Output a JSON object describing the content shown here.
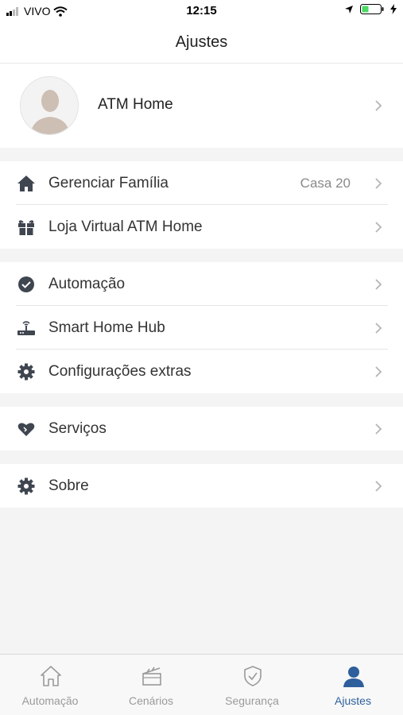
{
  "status_bar": {
    "carrier": "VIVO",
    "time": "12:15"
  },
  "header": {
    "title": "Ajustes"
  },
  "profile": {
    "name": "ATM Home"
  },
  "groups": [
    {
      "items": [
        {
          "label": "Gerenciar Família",
          "value": "Casa 20",
          "icon": "home-icon"
        },
        {
          "label": "Loja Virtual ATM Home",
          "icon": "gift-icon"
        }
      ]
    },
    {
      "items": [
        {
          "label": "Automação",
          "icon": "automation-icon"
        },
        {
          "label": "Smart Home Hub",
          "icon": "router-icon"
        },
        {
          "label": "Configurações extras",
          "icon": "gear-icon"
        }
      ]
    },
    {
      "items": [
        {
          "label": "Serviços",
          "icon": "heart-icon"
        }
      ]
    },
    {
      "items": [
        {
          "label": "Sobre",
          "icon": "gear-icon"
        }
      ]
    }
  ],
  "tabs": [
    {
      "label": "Automação",
      "icon": "home-outline-icon"
    },
    {
      "label": "Cenários",
      "icon": "clapperboard-icon"
    },
    {
      "label": "Segurança",
      "icon": "shield-check-icon"
    },
    {
      "label": "Ajustes",
      "icon": "person-icon",
      "active": true
    }
  ],
  "colors": {
    "accent": "#2e5f9c",
    "icon": "#3f4650",
    "background": "#f4f4f5"
  }
}
